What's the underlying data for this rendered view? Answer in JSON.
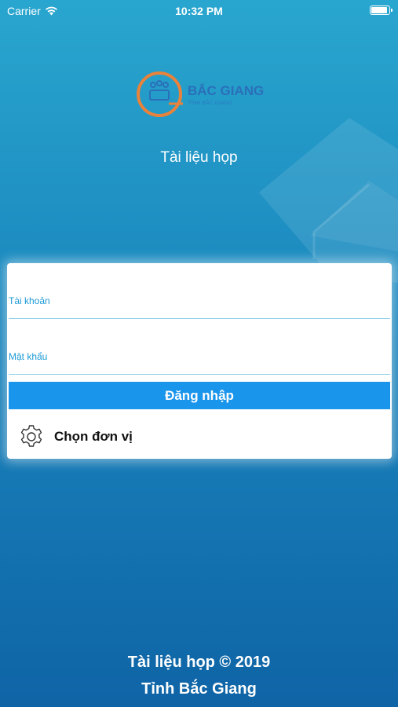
{
  "status_bar": {
    "carrier": "Carrier",
    "time": "10:32 PM",
    "battery_level": 1.0
  },
  "logo": {
    "name": "BẮC GIANG",
    "subtitle": "TỈNH BẮC GIANG"
  },
  "app_title": "Tài liệu họp",
  "login_form": {
    "account_label": "Tài khoản",
    "account_value": "",
    "password_label": "Mật khẩu",
    "password_value": "",
    "login_button": "Đăng nhập",
    "choose_unit": "Chọn đơn vị"
  },
  "footer": {
    "line1": "Tài liệu họp © 2019",
    "line2": "Tỉnh Bắc Giang"
  },
  "colors": {
    "accent": "#1a95ec",
    "label": "#1d9ad6",
    "logo_orange": "#e9823a",
    "logo_blue": "#2a6fb8"
  },
  "icons": {
    "wifi": "wifi-icon",
    "battery": "battery-icon",
    "settings": "gear-icon"
  }
}
